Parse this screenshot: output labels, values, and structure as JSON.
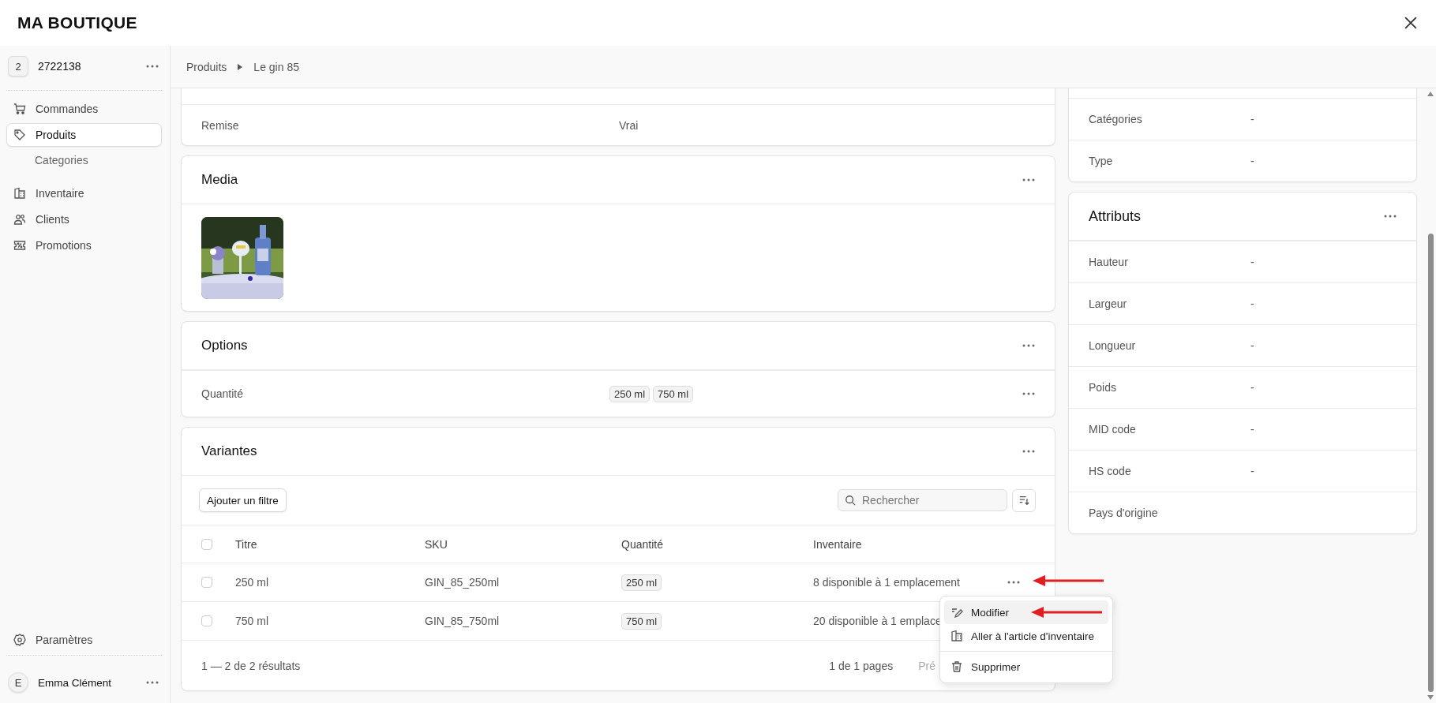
{
  "app": {
    "brand": "MA BOUTIQUE"
  },
  "sidebar": {
    "store": {
      "badge": "2",
      "name": "2722138"
    },
    "items": [
      {
        "label": "Commandes",
        "selected": false
      },
      {
        "label": "Produits",
        "selected": true,
        "children": [
          {
            "label": "Categories",
            "selected": false
          }
        ]
      },
      {
        "label": "Inventaire",
        "selected": false
      },
      {
        "label": "Clients",
        "selected": false
      },
      {
        "label": "Promotions",
        "selected": false
      }
    ],
    "settings": {
      "label": "Paramètres"
    },
    "user": {
      "initial": "E",
      "name": "Emma Clément"
    }
  },
  "breadcrumb": [
    "Produits",
    "Le gin 85"
  ],
  "details_card": {
    "rows": [
      {
        "label": "Remise",
        "value": "Vrai"
      }
    ]
  },
  "media": {
    "title": "Media"
  },
  "options": {
    "title": "Options",
    "rows": [
      {
        "label": "Quantité",
        "values": [
          "250 ml",
          "750 ml"
        ]
      }
    ]
  },
  "variants": {
    "title": "Variantes",
    "filter_button": "Ajouter un filtre",
    "search": {
      "placeholder": "Rechercher"
    },
    "columns": [
      "Titre",
      "SKU",
      "Quantité",
      "Inventaire"
    ],
    "all_checked": false,
    "rows": [
      {
        "title": "250 ml",
        "sku": "GIN_85_250ml",
        "quantity": "250 ml",
        "inventory": "8 disponible à 1 emplacement",
        "checked": false,
        "annotated": true
      },
      {
        "title": "750 ml",
        "sku": "GIN_85_750ml",
        "quantity": "750 ml",
        "inventory": "20 disponible à 1 emplace",
        "checked": false,
        "annotated": false
      }
    ],
    "footer": {
      "range": "1 — 2 de 2 résultats",
      "pages": "1 de 1 pages",
      "prev": "Pré"
    }
  },
  "menu": {
    "items": [
      {
        "label": "Modifier",
        "selected": true,
        "annotated": true
      },
      {
        "label": "Aller à l'article d'inventaire",
        "selected": false,
        "annotated": false
      },
      {
        "label": "Supprimer",
        "selected": false,
        "annotated": false
      }
    ]
  },
  "general_card": {
    "rows": [
      {
        "label": "Catégories",
        "value": "-"
      },
      {
        "label": "Type",
        "value": "-"
      }
    ]
  },
  "attributes": {
    "title": "Attributs",
    "rows": [
      {
        "label": "Hauteur",
        "value": "-"
      },
      {
        "label": "Largeur",
        "value": "-"
      },
      {
        "label": "Longueur",
        "value": "-"
      },
      {
        "label": "Poids",
        "value": "-"
      },
      {
        "label": "MID code",
        "value": "-"
      },
      {
        "label": "HS code",
        "value": "-"
      },
      {
        "label": "Pays d'origine"
      }
    ]
  }
}
